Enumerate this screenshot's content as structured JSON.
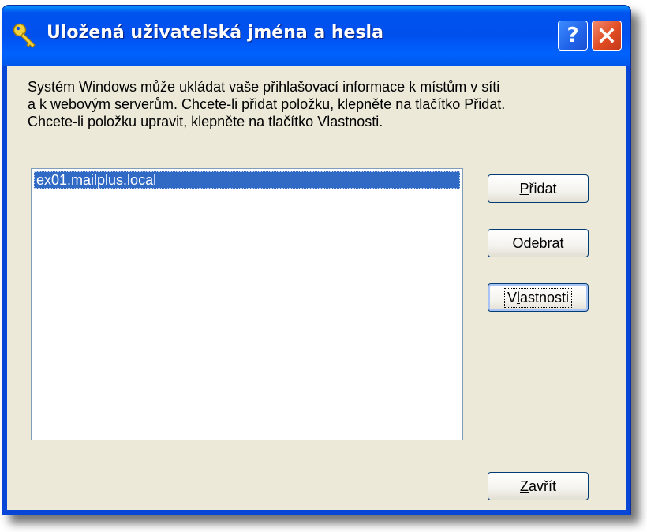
{
  "window": {
    "title": "Uložená uživatelská jména a hesla",
    "help_glyph": "?",
    "title_icon": "keys-icon",
    "close_icon": "close-icon"
  },
  "description": {
    "line1": "Systém Windows může ukládat vaše přihlašovací informace k místům v síti",
    "line2": "a k webovým serverům. Chcete-li přidat položku, klepněte na tlačítko Přidat.",
    "line3": "Chcete-li položku upravit, klepněte na tlačítko Vlastnosti."
  },
  "list": {
    "items": [
      {
        "label": "ex01.mailplus.local",
        "selected": true
      }
    ]
  },
  "buttons": {
    "add": {
      "label": "Přidat",
      "access_key": "P"
    },
    "remove": {
      "label": "Odebrat",
      "access_key": "d"
    },
    "properties": {
      "label": "Vlastnosti",
      "access_key": "l"
    },
    "close": {
      "label": "Zavřít",
      "access_key": "Z"
    }
  },
  "colors": {
    "titlebar": "#0053ee",
    "client_bg": "#ece9d8",
    "selection": "#316ac5",
    "close_button": "#e04b22"
  }
}
